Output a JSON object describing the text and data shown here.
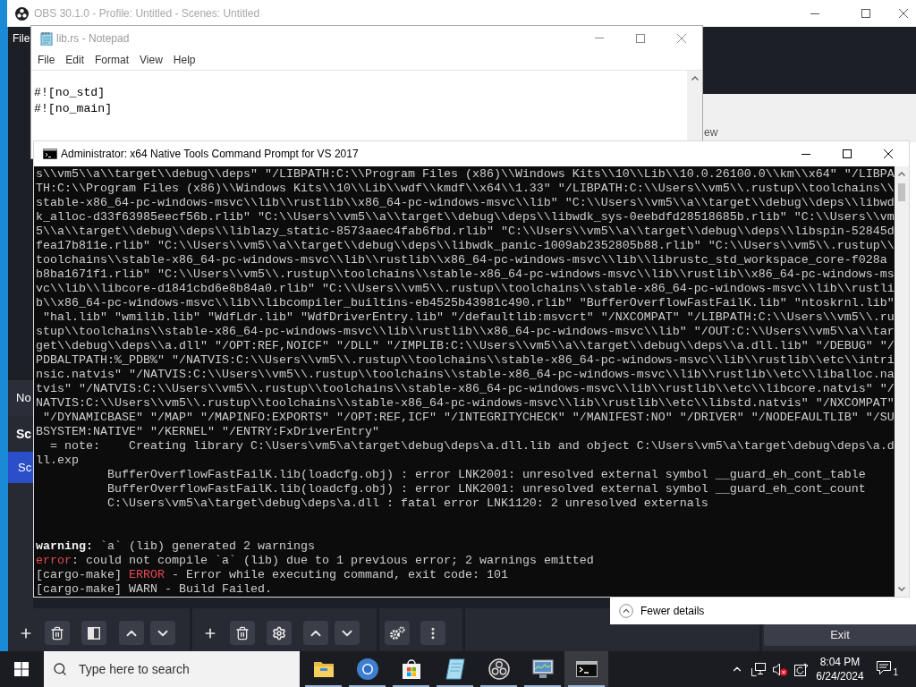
{
  "obs_window": {
    "title": "OBS 30.1.0 - Profile: Untitled - Scenes: Untitled",
    "menu": [
      "File"
    ],
    "context_bar": "No",
    "scenes_dock": {
      "title": "Sc",
      "items": [
        {
          "label": "Sc",
          "selected": true
        }
      ]
    },
    "exit_button": "Exit"
  },
  "task_manager": {
    "menu": [
      "ew"
    ],
    "footer": "Fewer details"
  },
  "notepad": {
    "title": "lib.rs - Notepad",
    "menu": [
      "File",
      "Edit",
      "Format",
      "View",
      "Help"
    ],
    "lines": [
      "#![no_std]",
      "#![no_main]"
    ]
  },
  "console": {
    "title": "Administrator: x64 Native Tools Command Prompt for VS 2017",
    "blocks": [
      {
        "lines": [
          {
            "text": "s\\\\vm5\\\\a\\\\target\\\\debug\\\\deps\" \"/LIBPATH:C:\\\\Program Files (x86)\\\\Windows Kits\\\\10\\\\Lib\\\\10.0.26100.0\\\\km\\\\x64\" \"/LIBPA"
          },
          {
            "text": "TH:C:\\\\Program Files (x86)\\\\Windows Kits\\\\10\\\\Lib\\\\wdf\\\\kmdf\\\\x64\\\\1.33\" \"/LIBPATH:C:\\\\Users\\\\vm5\\\\.rustup\\\\toolchains\\\\"
          },
          {
            "text": "stable-x86_64-pc-windows-msvc\\\\lib\\\\rustlib\\\\x86_64-pc-windows-msvc\\\\lib\" \"C:\\\\Users\\\\vm5\\\\a\\\\target\\\\debug\\\\deps\\\\libwd"
          },
          {
            "text": "k_alloc-d33f63985eecf56b.rlib\" \"C:\\\\Users\\\\vm5\\\\a\\\\target\\\\debug\\\\deps\\\\libwdk_sys-0eebdfd28518685b.rlib\" \"C:\\\\Users\\\\vm"
          },
          {
            "text": "5\\\\a\\\\target\\\\debug\\\\deps\\\\liblazy_static-8573aaec4fab6fbd.rlib\" \"C:\\\\Users\\\\vm5\\\\a\\\\target\\\\debug\\\\deps\\\\libspin-52845d"
          },
          {
            "text": "fea17b811e.rlib\" \"C:\\\\Users\\\\vm5\\\\a\\\\target\\\\debug\\\\deps\\\\libwdk_panic-1009ab2352805b88.rlib\" \"C:\\\\Users\\\\vm5\\\\.rustup\\\\"
          },
          {
            "text": "toolchains\\\\stable-x86_64-pc-windows-msvc\\\\lib\\\\rustlib\\\\x86_64-pc-windows-msvc\\\\lib\\\\librustc_std_workspace_core-f028a"
          },
          {
            "text": "b8ba1671f1.rlib\" \"C:\\\\Users\\\\vm5\\\\.rustup\\\\toolchains\\\\stable-x86_64-pc-windows-msvc\\\\lib\\\\rustlib\\\\x86_64-pc-windows-ms"
          },
          {
            "text": "vc\\\\lib\\\\libcore-d1841cbd6e8b84a0.rlib\" \"C:\\\\Users\\\\vm5\\\\.rustup\\\\toolchains\\\\stable-x86_64-pc-windows-msvc\\\\lib\\\\rustli"
          },
          {
            "text": "b\\\\x86_64-pc-windows-msvc\\\\lib\\\\libcompiler_builtins-eb4525b43981c490.rlib\" \"BufferOverflowFastFailK.lib\" \"ntoskrnl.lib\""
          },
          {
            "text": " \"hal.lib\" \"wmilib.lib\" \"WdfLdr.lib\" \"WdfDriverEntry.lib\" \"/defaultlib:msvcrt\" \"/NXCOMPAT\" \"/LIBPATH:C:\\\\Users\\\\vm5\\\\.ru"
          },
          {
            "text": "stup\\\\toolchains\\\\stable-x86_64-pc-windows-msvc\\\\lib\\\\rustlib\\\\x86_64-pc-windows-msvc\\\\lib\" \"/OUT:C:\\\\Users\\\\vm5\\\\a\\\\tar"
          },
          {
            "text": "get\\\\debug\\\\deps\\\\a.dll\" \"/OPT:REF,NOICF\" \"/DLL\" \"/IMPLIB:C:\\\\Users\\\\vm5\\\\a\\\\target\\\\debug\\\\deps\\\\a.dll.lib\" \"/DEBUG\" \"/"
          },
          {
            "text": "PDBALTPATH:%_PDB%\" \"/NATVIS:C:\\\\Users\\\\vm5\\\\.rustup\\\\toolchains\\\\stable-x86_64-pc-windows-msvc\\\\lib\\\\rustlib\\\\etc\\\\intri"
          },
          {
            "text": "nsic.natvis\" \"/NATVIS:C:\\\\Users\\\\vm5\\\\.rustup\\\\toolchains\\\\stable-x86_64-pc-windows-msvc\\\\lib\\\\rustlib\\\\etc\\\\liballoc.na"
          },
          {
            "text": "tvis\" \"/NATVIS:C:\\\\Users\\\\vm5\\\\.rustup\\\\toolchains\\\\stable-x86_64-pc-windows-msvc\\\\lib\\\\rustlib\\\\etc\\\\libcore.natvis\" \"/"
          },
          {
            "text": "NATVIS:C:\\\\Users\\\\vm5\\\\.rustup\\\\toolchains\\\\stable-x86_64-pc-windows-msvc\\\\lib\\\\rustlib\\\\etc\\\\libstd.natvis\" \"/NXCOMPAT\""
          },
          {
            "text": " \"/DYNAMICBASE\" \"/MAP\" \"/MAPINFO:EXPORTS\" \"/OPT:REF,ICF\" \"/INTEGRITYCHECK\" \"/MANIFEST:NO\" \"/DRIVER\" \"/NODEFAULTLIB\" \"/SU"
          },
          {
            "text": "BSYSTEM:NATIVE\" \"/KERNEL\" \"/ENTRY:FxDriverEntry\""
          },
          {
            "text": "  = note:    Creating library C:\\Users\\vm5\\a\\target\\debug\\deps\\a.dll.lib and object C:\\Users\\vm5\\a\\target\\debug\\deps\\a.d"
          },
          {
            "text": "ll.exp"
          },
          {
            "text": "          BufferOverflowFastFailK.lib(loadcfg.obj) : error LNK2001: unresolved external symbol __guard_eh_cont_table"
          },
          {
            "text": "          BufferOverflowFastFailK.lib(loadcfg.obj) : error LNK2001: unresolved external symbol __guard_eh_cont_count"
          },
          {
            "text": "          C:\\Users\\vm5\\a\\target\\debug\\deps\\a.dll : fatal error LNK1120: 2 unresolved externals"
          }
        ]
      },
      {
        "lines": [
          {
            "segments": [
              {
                "text": "warning:",
                "kind": "bright"
              },
              {
                "text": " `a` (lib) generated 2 warnings",
                "kind": "plain"
              }
            ]
          },
          {
            "segments": [
              {
                "text": "error",
                "kind": "error"
              },
              {
                "text": ": could not compile `a` (lib) due to 1 previous error; 2 warnings emitted",
                "kind": "plain"
              }
            ]
          },
          {
            "segments": [
              {
                "text": "[cargo-make] ",
                "kind": "plain"
              },
              {
                "text": "ERROR",
                "kind": "error"
              },
              {
                "text": " - Error while executing command, exit code: 101",
                "kind": "plain"
              }
            ]
          },
          {
            "text": "[cargo-make] WARN - Build Failed."
          }
        ]
      }
    ]
  },
  "taskbar": {
    "search": {
      "placeholder": "Type here to search"
    },
    "apps": [
      {
        "running": true,
        "active": false
      },
      {
        "running": true,
        "active": false
      },
      {
        "running": true,
        "active": false
      },
      {
        "running": true,
        "active": false
      },
      {
        "running": true,
        "active": false
      },
      {
        "running": true,
        "active": false
      },
      {
        "running": true,
        "active": true
      }
    ],
    "tray": {
      "volume_muted": true,
      "time": "8:04 PM",
      "date": "6/24/2024",
      "notification_count": "1"
    }
  }
}
